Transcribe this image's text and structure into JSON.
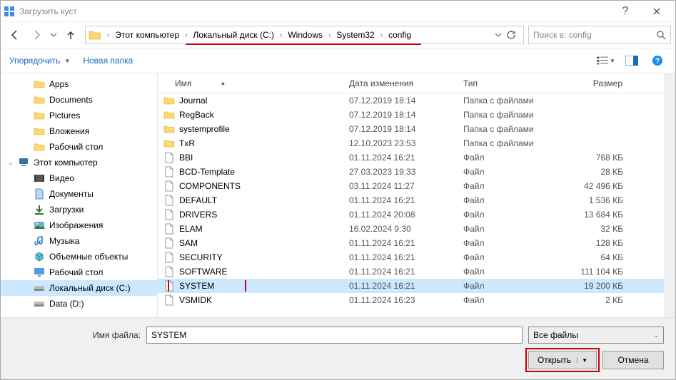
{
  "window": {
    "title": "Загрузить куст"
  },
  "breadcrumb": {
    "items": [
      "Этот компьютер",
      "Локальный диск (C:)",
      "Windows",
      "System32",
      "config"
    ]
  },
  "search": {
    "placeholder": "Поиск в: config"
  },
  "toolbar": {
    "organize": "Упорядочить",
    "newfolder": "Новая папка"
  },
  "tree": {
    "items": [
      {
        "label": "Apps",
        "icon": "folder",
        "indent": 1
      },
      {
        "label": "Documents",
        "icon": "folder",
        "indent": 1
      },
      {
        "label": "Pictures",
        "icon": "folder",
        "indent": 1
      },
      {
        "label": "Вложения",
        "icon": "folder",
        "indent": 1
      },
      {
        "label": "Рабочий стол",
        "icon": "folder",
        "indent": 1
      },
      {
        "label": "Этот компьютер",
        "icon": "pc",
        "indent": 0,
        "expand": "open"
      },
      {
        "label": "Видео",
        "icon": "video",
        "indent": 1
      },
      {
        "label": "Документы",
        "icon": "docs",
        "indent": 1
      },
      {
        "label": "Загрузки",
        "icon": "download",
        "indent": 1
      },
      {
        "label": "Изображения",
        "icon": "images",
        "indent": 1
      },
      {
        "label": "Музыка",
        "icon": "music",
        "indent": 1
      },
      {
        "label": "Объемные объекты",
        "icon": "3d",
        "indent": 1
      },
      {
        "label": "Рабочий стол",
        "icon": "desktop",
        "indent": 1
      },
      {
        "label": "Локальный диск (C:)",
        "icon": "drive",
        "indent": 1,
        "selected": true
      },
      {
        "label": "Data (D:)",
        "icon": "drive",
        "indent": 1
      }
    ]
  },
  "columns": {
    "name": "Имя",
    "date": "Дата изменения",
    "type": "Тип",
    "size": "Размер"
  },
  "files": [
    {
      "name": "Journal",
      "date": "07.12.2019 18:14",
      "type": "Папка с файлами",
      "size": "",
      "icon": "folder"
    },
    {
      "name": "RegBack",
      "date": "07.12.2019 18:14",
      "type": "Папка с файлами",
      "size": "",
      "icon": "folder"
    },
    {
      "name": "systemprofile",
      "date": "07.12.2019 18:14",
      "type": "Папка с файлами",
      "size": "",
      "icon": "folder"
    },
    {
      "name": "TxR",
      "date": "12.10.2023 23:53",
      "type": "Папка с файлами",
      "size": "",
      "icon": "folder"
    },
    {
      "name": "BBI",
      "date": "01.11.2024 16:21",
      "type": "Файл",
      "size": "768 КБ",
      "icon": "file"
    },
    {
      "name": "BCD-Template",
      "date": "27.03.2023 19:33",
      "type": "Файл",
      "size": "28 КБ",
      "icon": "file"
    },
    {
      "name": "COMPONENTS",
      "date": "03.11.2024 11:27",
      "type": "Файл",
      "size": "42 496 КБ",
      "icon": "file"
    },
    {
      "name": "DEFAULT",
      "date": "01.11.2024 16:21",
      "type": "Файл",
      "size": "1 536 КБ",
      "icon": "file"
    },
    {
      "name": "DRIVERS",
      "date": "01.11.2024 20:08",
      "type": "Файл",
      "size": "13 684 КБ",
      "icon": "file"
    },
    {
      "name": "ELAM",
      "date": "16.02.2024 9:30",
      "type": "Файл",
      "size": "32 КБ",
      "icon": "file"
    },
    {
      "name": "SAM",
      "date": "01.11.2024 16:21",
      "type": "Файл",
      "size": "128 КБ",
      "icon": "file"
    },
    {
      "name": "SECURITY",
      "date": "01.11.2024 16:21",
      "type": "Файл",
      "size": "64 КБ",
      "icon": "file"
    },
    {
      "name": "SOFTWARE",
      "date": "01.11.2024 16:21",
      "type": "Файл",
      "size": "111 104 КБ",
      "icon": "file"
    },
    {
      "name": "SYSTEM",
      "date": "01.11.2024 16:21",
      "type": "Файл",
      "size": "19 200 КБ",
      "icon": "file",
      "selected": true,
      "redbox": true
    },
    {
      "name": "VSMIDK",
      "date": "01.11.2024 16:23",
      "type": "Файл",
      "size": "2 КБ",
      "icon": "file"
    }
  ],
  "footer": {
    "filename_label": "Имя файла:",
    "filename_value": "SYSTEM",
    "filter": "Все файлы",
    "open": "Открыть",
    "cancel": "Отмена"
  }
}
